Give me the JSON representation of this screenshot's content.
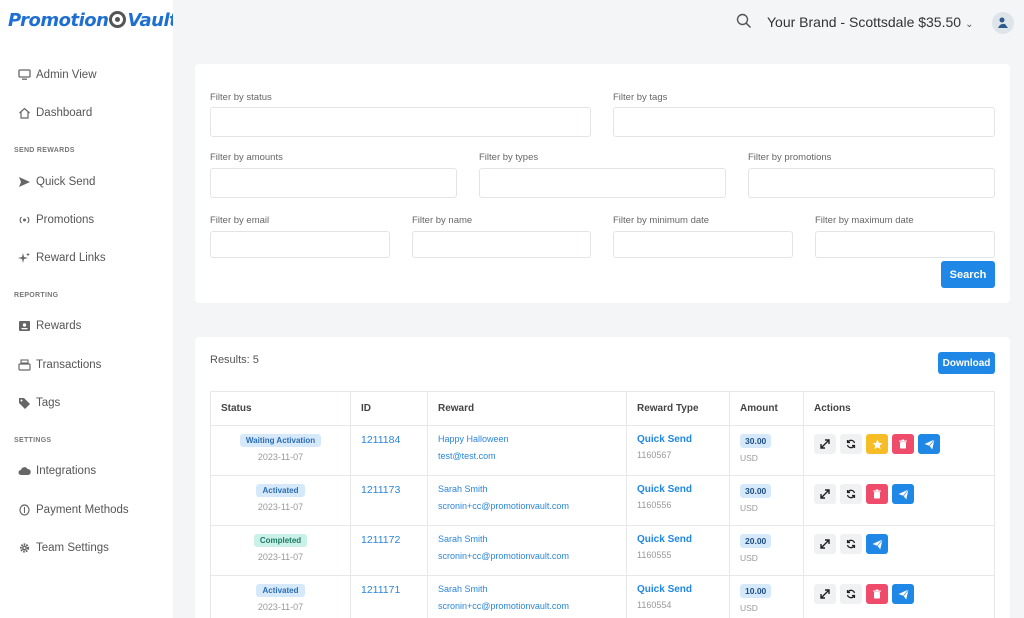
{
  "app": {
    "logo_left": "Promotion",
    "logo_right": "Vault"
  },
  "header": {
    "brand_selector": "Your Brand - Scottsdale $35.50",
    "chevron": "⌄"
  },
  "sidebar": {
    "items": [
      {
        "label": "Admin View",
        "icon": "monitor-icon"
      },
      {
        "label": "Dashboard",
        "icon": "home-icon"
      },
      {
        "section": "SEND REWARDS"
      },
      {
        "label": "Quick Send",
        "icon": "send-icon"
      },
      {
        "label": "Promotions",
        "icon": "broadcast-icon"
      },
      {
        "label": "Reward Links",
        "icon": "sparkle-icon"
      },
      {
        "section": "REPORTING"
      },
      {
        "label": "Rewards",
        "icon": "id-card-icon"
      },
      {
        "label": "Transactions",
        "icon": "register-icon"
      },
      {
        "label": "Tags",
        "icon": "tag-icon"
      },
      {
        "section": "SETTINGS"
      },
      {
        "label": "Integrations",
        "icon": "cloud-icon"
      },
      {
        "label": "Payment Methods",
        "icon": "coin-icon"
      },
      {
        "label": "Team Settings",
        "icon": "gear-icon"
      }
    ]
  },
  "filters": {
    "status": "Filter by status",
    "tags": "Filter by tags",
    "amounts": "Filter by amounts",
    "types": "Filter by types",
    "promotions": "Filter by promotions",
    "email": "Filter by email",
    "name": "Filter by name",
    "min_date": "Filter by minimum date",
    "max_date": "Filter by maximum date",
    "search_label": "Search"
  },
  "results": {
    "label": "Results: 5",
    "download_label": "Download",
    "columns": [
      "Status",
      "ID",
      "Reward",
      "Reward Type",
      "Amount",
      "Actions"
    ],
    "rows": [
      {
        "status": "Waiting Activation",
        "status_color": "blue",
        "date": "2023-11-07",
        "id": "1211184",
        "reward_name": "Happy Halloween",
        "reward_email": "test@test.com",
        "type": "Quick Send",
        "type_id": "1160567",
        "amount": "30.00",
        "currency": "USD",
        "actions": [
          "expand",
          "refresh",
          "star",
          "delete",
          "send"
        ]
      },
      {
        "status": "Activated",
        "status_color": "blue",
        "date": "2023-11-07",
        "id": "1211173",
        "reward_name": "Sarah Smith",
        "reward_email": "scronin+cc@promotionvault.com",
        "type": "Quick Send",
        "type_id": "1160556",
        "amount": "30.00",
        "currency": "USD",
        "actions": [
          "expand",
          "refresh",
          "delete",
          "send"
        ]
      },
      {
        "status": "Completed",
        "status_color": "green",
        "date": "2023-11-07",
        "id": "1211172",
        "reward_name": "Sarah Smith",
        "reward_email": "scronin+cc@promotionvault.com",
        "type": "Quick Send",
        "type_id": "1160555",
        "amount": "20.00",
        "currency": "USD",
        "actions": [
          "expand",
          "refresh",
          "send"
        ]
      },
      {
        "status": "Activated",
        "status_color": "blue",
        "date": "2023-11-07",
        "id": "1211171",
        "reward_name": "Sarah Smith",
        "reward_email": "scronin+cc@promotionvault.com",
        "type": "Quick Send",
        "type_id": "1160554",
        "amount": "10.00",
        "currency": "USD",
        "actions": [
          "expand",
          "refresh",
          "delete",
          "send"
        ]
      }
    ]
  },
  "colors": {
    "primary": "#1f87e5",
    "danger": "#ef4b6b",
    "warning": "#f6bd27",
    "success_bg": "#c9f1e8",
    "info_bg": "#d6e9fb"
  }
}
